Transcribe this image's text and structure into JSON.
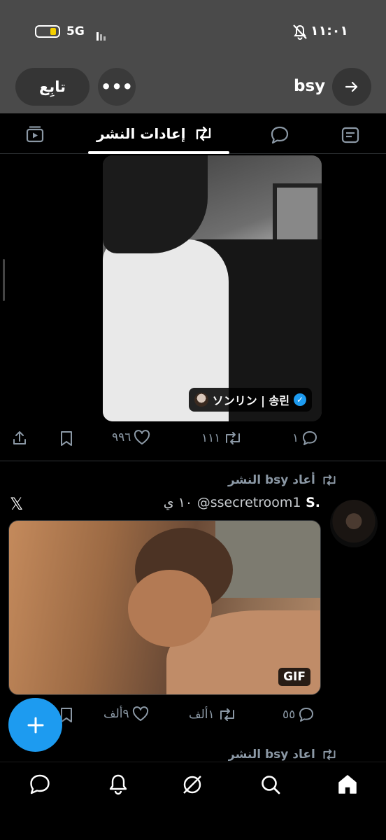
{
  "status_bar": {
    "network": "5G",
    "time": "١١:٠١"
  },
  "profile_header": {
    "follow_label": "تابِع",
    "more_label": "•••",
    "name": "bsy"
  },
  "tabs": {
    "active_label": "إعادات النشر"
  },
  "post1": {
    "watermark_text": "ソンリン | 송린",
    "actions": {
      "replies": "١",
      "reposts": "١١١",
      "likes": "٩٩٦"
    }
  },
  "post2": {
    "repost_text": "أعاد bsy النشر",
    "display_name": "S.",
    "handle": "@ssecretroom1",
    "time": "١٠ ي",
    "gif_label": "GIF",
    "actions": {
      "replies": "٥٥",
      "reposts": "١ألف",
      "likes": "٩ألف"
    }
  },
  "post3_peek": {
    "repost_text": "أعاد bsy النشر"
  },
  "colors": {
    "accent": "#1d9bf0",
    "muted": "#8b98a5",
    "header_bg": "#4a4a4a"
  }
}
